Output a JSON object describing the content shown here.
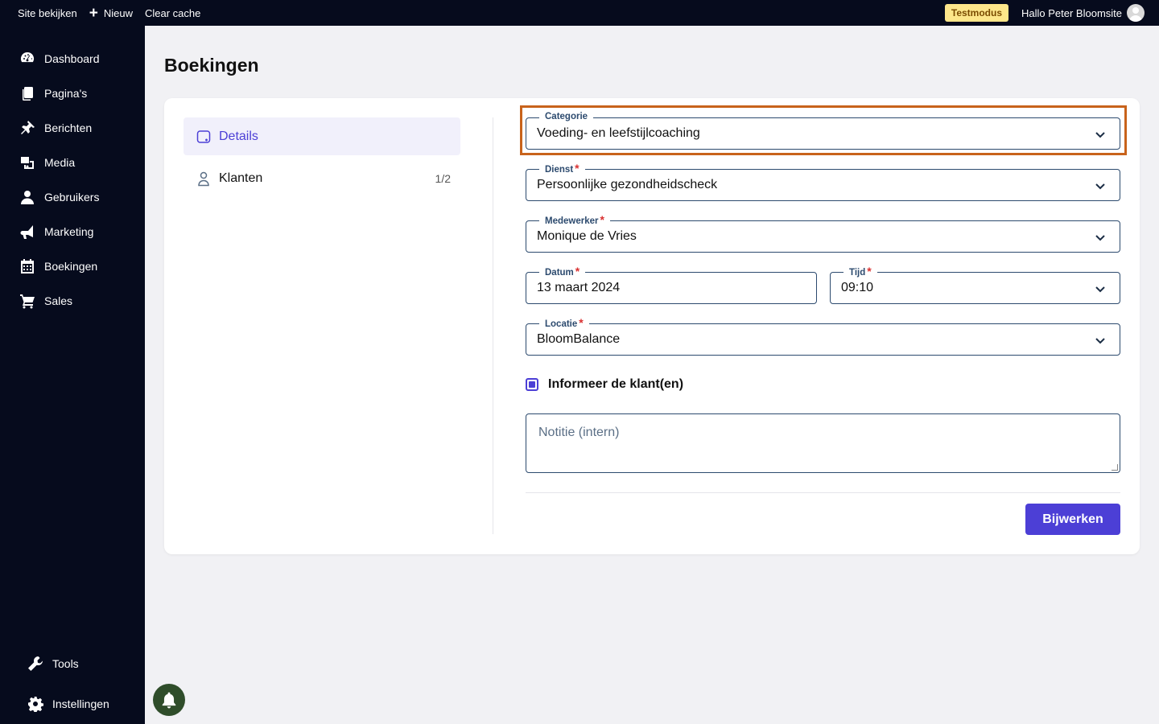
{
  "topbar": {
    "view_site": "Site bekijken",
    "new": "Nieuw",
    "clear_cache": "Clear cache",
    "test_mode": "Testmodus",
    "greeting": "Hallo Peter Bloomsite"
  },
  "sidebar": {
    "items": [
      {
        "label": "Dashboard",
        "icon": "dashboard-icon"
      },
      {
        "label": "Pagina's",
        "icon": "pages-icon"
      },
      {
        "label": "Berichten",
        "icon": "pin-icon"
      },
      {
        "label": "Media",
        "icon": "media-icon"
      },
      {
        "label": "Gebruikers",
        "icon": "user-icon"
      },
      {
        "label": "Marketing",
        "icon": "megaphone-icon"
      },
      {
        "label": "Boekingen",
        "icon": "calendar-icon"
      },
      {
        "label": "Sales",
        "icon": "cart-icon"
      }
    ],
    "bottom": [
      {
        "label": "Tools",
        "icon": "wrench-icon"
      },
      {
        "label": "Instellingen",
        "icon": "gear-icon"
      }
    ]
  },
  "page": {
    "title": "Boekingen"
  },
  "tabs": [
    {
      "label": "Details",
      "icon": "details-icon",
      "active": true
    },
    {
      "label": "Klanten",
      "icon": "person-icon",
      "count": "1/2"
    }
  ],
  "form": {
    "categorie": {
      "label": "Categorie",
      "value": "Voeding- en leefstijlcoaching",
      "required": false
    },
    "dienst": {
      "label": "Dienst",
      "value": "Persoonlijke gezondheidscheck",
      "required": true
    },
    "medewerker": {
      "label": "Medewerker",
      "value": "Monique de Vries",
      "required": true
    },
    "datum": {
      "label": "Datum",
      "value": "13 maart 2024",
      "required": true
    },
    "tijd": {
      "label": "Tijd",
      "value": "09:10",
      "required": true
    },
    "locatie": {
      "label": "Locatie",
      "value": "BloomBalance",
      "required": true
    },
    "inform_label": "Informeer de klant(en)",
    "inform_checked": true,
    "note_placeholder": "Notitie (intern)",
    "submit_label": "Bijwerken",
    "required_mark": "*"
  },
  "colors": {
    "accent": "#4c3fd6",
    "dark": "#060b1d",
    "highlight": "#c8631b",
    "field_border": "#2c4a6e",
    "testmode": "#fde68a"
  }
}
